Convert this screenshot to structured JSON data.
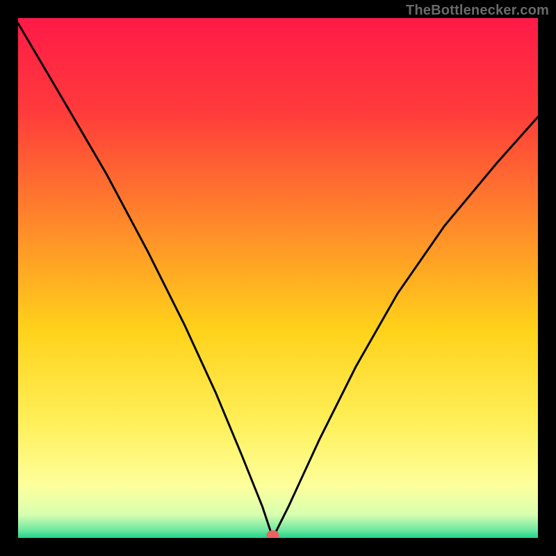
{
  "watermark": "TheBottlenecker.com",
  "chart_data": {
    "type": "line",
    "title": "",
    "xlabel": "",
    "ylabel": "",
    "xlim": [
      0,
      100
    ],
    "ylim": [
      0,
      100
    ],
    "grid": false,
    "legend": false,
    "marker": {
      "x": 49,
      "y": 0,
      "color": "#f06060"
    },
    "series": [
      {
        "name": "curve",
        "x": [
          0,
          10,
          17,
          25,
          32,
          38,
          43,
          47,
          49,
          52,
          58,
          65,
          73,
          82,
          92,
          100
        ],
        "y": [
          99,
          82,
          70,
          55,
          41,
          28,
          16,
          6,
          0,
          6,
          19,
          33,
          47,
          60,
          72,
          81
        ]
      }
    ],
    "background": {
      "type": "vertical-gradient",
      "stops": [
        {
          "pos": 0.0,
          "color": "#ff1a48"
        },
        {
          "pos": 0.18,
          "color": "#ff3b3b"
        },
        {
          "pos": 0.4,
          "color": "#ff8a2a"
        },
        {
          "pos": 0.6,
          "color": "#ffd21a"
        },
        {
          "pos": 0.78,
          "color": "#fff05a"
        },
        {
          "pos": 0.9,
          "color": "#fdff9c"
        },
        {
          "pos": 0.955,
          "color": "#d8ffb0"
        },
        {
          "pos": 0.985,
          "color": "#6ee8a0"
        },
        {
          "pos": 1.0,
          "color": "#1fd38a"
        }
      ]
    },
    "frame": {
      "color": "#000",
      "width": 26
    }
  }
}
